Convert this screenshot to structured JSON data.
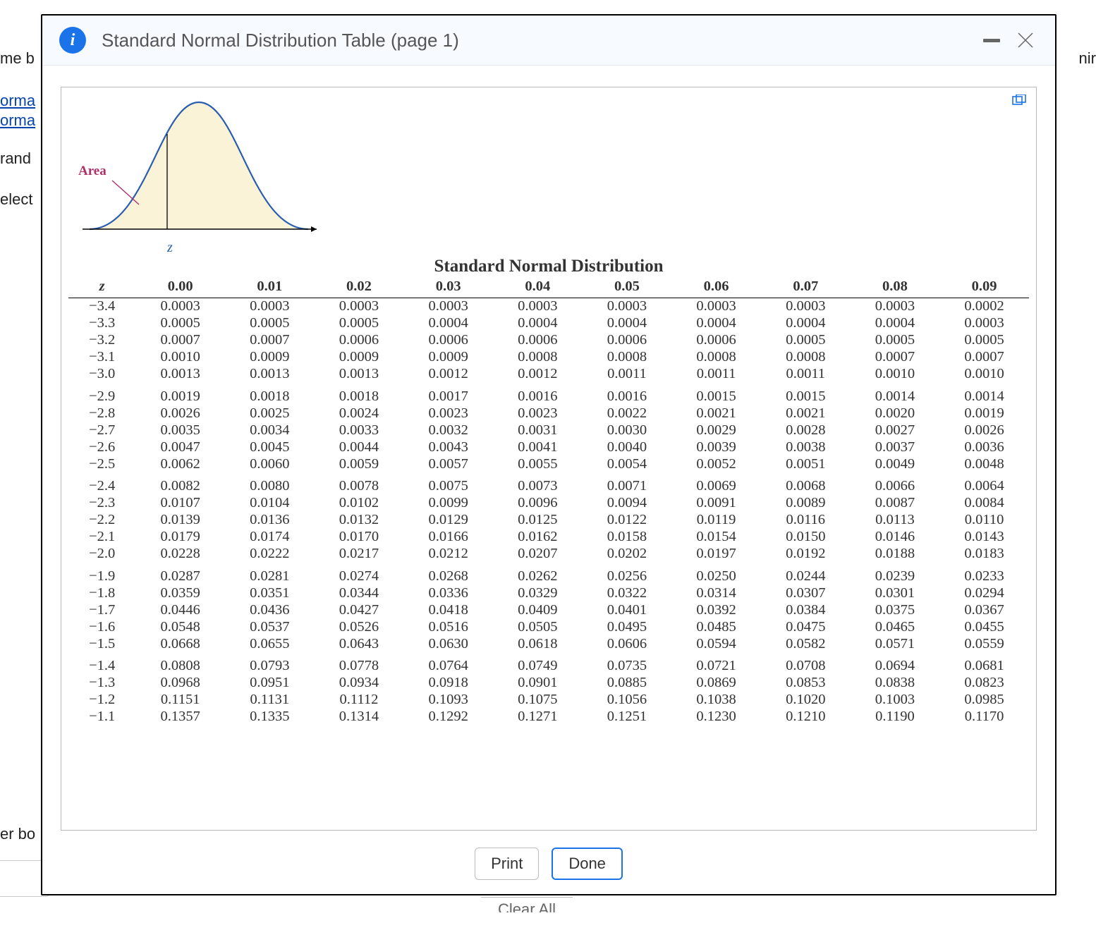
{
  "bg": {
    "frag_top": "me b",
    "frag_topright": "nir",
    "link1": "orma",
    "link2": "orma",
    "frag_rand": "rand",
    "frag_elect": "elect",
    "frag_bottom": "er bo",
    "clear": "Clear All"
  },
  "dialog": {
    "title": "Standard Normal Distribution Table (page 1)",
    "print": "Print",
    "done": "Done"
  },
  "curve": {
    "area_label": "Area",
    "z_label": "z"
  },
  "table": {
    "title": "Standard Normal Distribution",
    "z_head": "z",
    "col_headers": [
      "0.00",
      "0.01",
      "0.02",
      "0.03",
      "0.04",
      "0.05",
      "0.06",
      "0.07",
      "0.08",
      "0.09"
    ],
    "groups": [
      {
        "rows": [
          {
            "z": "−3.4",
            "v": [
              "0.0003",
              "0.0003",
              "0.0003",
              "0.0003",
              "0.0003",
              "0.0003",
              "0.0003",
              "0.0003",
              "0.0003",
              "0.0002"
            ]
          },
          {
            "z": "−3.3",
            "v": [
              "0.0005",
              "0.0005",
              "0.0005",
              "0.0004",
              "0.0004",
              "0.0004",
              "0.0004",
              "0.0004",
              "0.0004",
              "0.0003"
            ]
          },
          {
            "z": "−3.2",
            "v": [
              "0.0007",
              "0.0007",
              "0.0006",
              "0.0006",
              "0.0006",
              "0.0006",
              "0.0006",
              "0.0005",
              "0.0005",
              "0.0005"
            ]
          },
          {
            "z": "−3.1",
            "v": [
              "0.0010",
              "0.0009",
              "0.0009",
              "0.0009",
              "0.0008",
              "0.0008",
              "0.0008",
              "0.0008",
              "0.0007",
              "0.0007"
            ]
          },
          {
            "z": "−3.0",
            "v": [
              "0.0013",
              "0.0013",
              "0.0013",
              "0.0012",
              "0.0012",
              "0.0011",
              "0.0011",
              "0.0011",
              "0.0010",
              "0.0010"
            ]
          }
        ]
      },
      {
        "rows": [
          {
            "z": "−2.9",
            "v": [
              "0.0019",
              "0.0018",
              "0.0018",
              "0.0017",
              "0.0016",
              "0.0016",
              "0.0015",
              "0.0015",
              "0.0014",
              "0.0014"
            ]
          },
          {
            "z": "−2.8",
            "v": [
              "0.0026",
              "0.0025",
              "0.0024",
              "0.0023",
              "0.0023",
              "0.0022",
              "0.0021",
              "0.0021",
              "0.0020",
              "0.0019"
            ]
          },
          {
            "z": "−2.7",
            "v": [
              "0.0035",
              "0.0034",
              "0.0033",
              "0.0032",
              "0.0031",
              "0.0030",
              "0.0029",
              "0.0028",
              "0.0027",
              "0.0026"
            ]
          },
          {
            "z": "−2.6",
            "v": [
              "0.0047",
              "0.0045",
              "0.0044",
              "0.0043",
              "0.0041",
              "0.0040",
              "0.0039",
              "0.0038",
              "0.0037",
              "0.0036"
            ]
          },
          {
            "z": "−2.5",
            "v": [
              "0.0062",
              "0.0060",
              "0.0059",
              "0.0057",
              "0.0055",
              "0.0054",
              "0.0052",
              "0.0051",
              "0.0049",
              "0.0048"
            ]
          }
        ]
      },
      {
        "rows": [
          {
            "z": "−2.4",
            "v": [
              "0.0082",
              "0.0080",
              "0.0078",
              "0.0075",
              "0.0073",
              "0.0071",
              "0.0069",
              "0.0068",
              "0.0066",
              "0.0064"
            ]
          },
          {
            "z": "−2.3",
            "v": [
              "0.0107",
              "0.0104",
              "0.0102",
              "0.0099",
              "0.0096",
              "0.0094",
              "0.0091",
              "0.0089",
              "0.0087",
              "0.0084"
            ]
          },
          {
            "z": "−2.2",
            "v": [
              "0.0139",
              "0.0136",
              "0.0132",
              "0.0129",
              "0.0125",
              "0.0122",
              "0.0119",
              "0.0116",
              "0.0113",
              "0.0110"
            ]
          },
          {
            "z": "−2.1",
            "v": [
              "0.0179",
              "0.0174",
              "0.0170",
              "0.0166",
              "0.0162",
              "0.0158",
              "0.0154",
              "0.0150",
              "0.0146",
              "0.0143"
            ]
          },
          {
            "z": "−2.0",
            "v": [
              "0.0228",
              "0.0222",
              "0.0217",
              "0.0212",
              "0.0207",
              "0.0202",
              "0.0197",
              "0.0192",
              "0.0188",
              "0.0183"
            ]
          }
        ]
      },
      {
        "rows": [
          {
            "z": "−1.9",
            "v": [
              "0.0287",
              "0.0281",
              "0.0274",
              "0.0268",
              "0.0262",
              "0.0256",
              "0.0250",
              "0.0244",
              "0.0239",
              "0.0233"
            ]
          },
          {
            "z": "−1.8",
            "v": [
              "0.0359",
              "0.0351",
              "0.0344",
              "0.0336",
              "0.0329",
              "0.0322",
              "0.0314",
              "0.0307",
              "0.0301",
              "0.0294"
            ]
          },
          {
            "z": "−1.7",
            "v": [
              "0.0446",
              "0.0436",
              "0.0427",
              "0.0418",
              "0.0409",
              "0.0401",
              "0.0392",
              "0.0384",
              "0.0375",
              "0.0367"
            ]
          },
          {
            "z": "−1.6",
            "v": [
              "0.0548",
              "0.0537",
              "0.0526",
              "0.0516",
              "0.0505",
              "0.0495",
              "0.0485",
              "0.0475",
              "0.0465",
              "0.0455"
            ]
          },
          {
            "z": "−1.5",
            "v": [
              "0.0668",
              "0.0655",
              "0.0643",
              "0.0630",
              "0.0618",
              "0.0606",
              "0.0594",
              "0.0582",
              "0.0571",
              "0.0559"
            ]
          }
        ]
      },
      {
        "rows": [
          {
            "z": "−1.4",
            "v": [
              "0.0808",
              "0.0793",
              "0.0778",
              "0.0764",
              "0.0749",
              "0.0735",
              "0.0721",
              "0.0708",
              "0.0694",
              "0.0681"
            ]
          },
          {
            "z": "−1.3",
            "v": [
              "0.0968",
              "0.0951",
              "0.0934",
              "0.0918",
              "0.0901",
              "0.0885",
              "0.0869",
              "0.0853",
              "0.0838",
              "0.0823"
            ]
          },
          {
            "z": "−1.2",
            "v": [
              "0.1151",
              "0.1131",
              "0.1112",
              "0.1093",
              "0.1075",
              "0.1056",
              "0.1038",
              "0.1020",
              "0.1003",
              "0.0985"
            ]
          },
          {
            "z": "−1.1",
            "v": [
              "0.1357",
              "0.1335",
              "0.1314",
              "0.1292",
              "0.1271",
              "0.1251",
              "0.1230",
              "0.1210",
              "0.1190",
              "0.1170"
            ]
          }
        ]
      }
    ]
  }
}
